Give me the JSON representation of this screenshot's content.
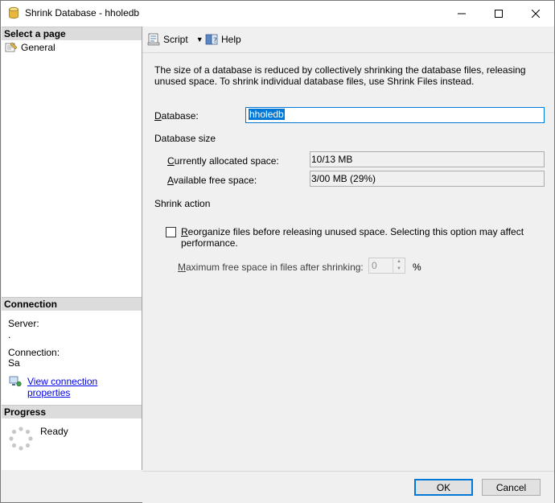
{
  "window": {
    "title": "Shrink Database - hholedb",
    "minimize_glyph": "—",
    "maximize_glyph": "☐",
    "close_glyph": "✕"
  },
  "left_panel": {
    "select_page_header": "Select a page",
    "pages": [
      {
        "label": "General",
        "icon": "general-page-icon"
      }
    ],
    "connection_header": "Connection",
    "server_label": "Server:",
    "server_value": ".",
    "connection_label": "Connection:",
    "connection_value": "Sa",
    "view_connection_link": "View connection properties",
    "progress_header": "Progress",
    "progress_status": "Ready"
  },
  "toolbar": {
    "script_label": "Script",
    "help_label": "Help"
  },
  "main": {
    "description": "The size of a database is reduced by collectively shrinking the database files, releasing unused space. To shrink individual database files, use Shrink Files instead.",
    "database_label": "Database:",
    "database_value": "hholedb",
    "database_size_heading": "Database size",
    "allocated_label": "Currently allocated space:",
    "allocated_value": "10/13 MB",
    "free_label": "Available free space:",
    "free_value": "3/00 MB (29%)",
    "shrink_action_heading": "Shrink action",
    "reorganize_label": "Reorganize files before releasing unused space.  Selecting this option may affect performance.",
    "reorganize_checked": false,
    "max_free_label": "Maximum free space in files after shrinking:",
    "max_free_value": "0",
    "percent_unit": "%"
  },
  "footer": {
    "ok_label": "OK",
    "cancel_label": "Cancel"
  }
}
